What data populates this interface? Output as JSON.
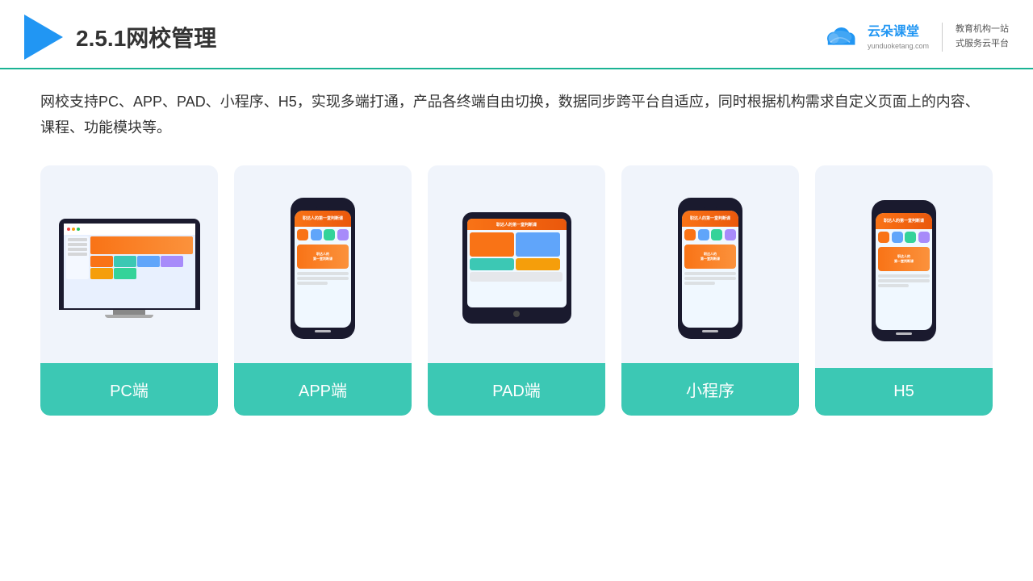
{
  "header": {
    "title": "2.5.1网校管理",
    "logo_main": "云朵课堂",
    "logo_domain": "yunduoketang.com",
    "logo_slogan_line1": "教育机构一站",
    "logo_slogan_line2": "式服务云平台"
  },
  "description": {
    "text": "网校支持PC、APP、PAD、小程序、H5，实现多端打通，产品各终端自由切换，数据同步跨平台自适应，同时根据机构需求自定义页面上的内容、课程、功能模块等。"
  },
  "cards": [
    {
      "id": "pc",
      "label": "PC端"
    },
    {
      "id": "app",
      "label": "APP端"
    },
    {
      "id": "pad",
      "label": "PAD端"
    },
    {
      "id": "miniprogram",
      "label": "小程序"
    },
    {
      "id": "h5",
      "label": "H5"
    }
  ],
  "colors": {
    "teal": "#3cc8b4",
    "blue": "#2196f3",
    "card_bg": "#eef2fb"
  }
}
